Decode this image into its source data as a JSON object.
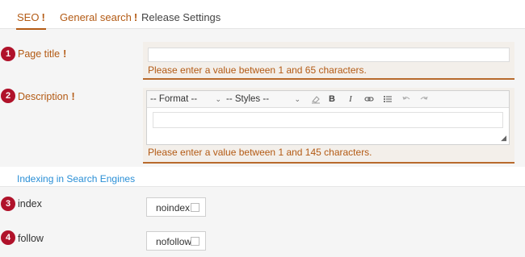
{
  "tabs": [
    {
      "label": "SEO",
      "required": "!"
    },
    {
      "label": "General search",
      "required": "!"
    },
    {
      "label": "Release Settings"
    }
  ],
  "fields": {
    "title": {
      "number": "1",
      "label": "Page title",
      "required": "!",
      "value": "",
      "message": "Please enter a value between 1 and 65 characters."
    },
    "description": {
      "number": "2",
      "label": "Description",
      "required": "!",
      "value": "",
      "message": "Please enter a value between 1 and 145 characters."
    }
  },
  "toolbar": {
    "format": "-- Format --",
    "styles": "-- Styles --",
    "bold": "B",
    "italic": "I",
    "icons": [
      "eraser-icon",
      "bold-icon",
      "italic-icon",
      "link-icon",
      "bullet-list-icon",
      "undo-icon",
      "redo-icon"
    ]
  },
  "indexing": {
    "heading": "Indexing in Search Engines",
    "index": {
      "number": "3",
      "label": "index",
      "option": "noindex",
      "checked": false
    },
    "follow": {
      "number": "4",
      "label": "follow",
      "option": "nofollow",
      "checked": false
    }
  },
  "colors": {
    "accent": "#b35a14",
    "badge": "#b0122a",
    "link": "#2a8fd6"
  }
}
